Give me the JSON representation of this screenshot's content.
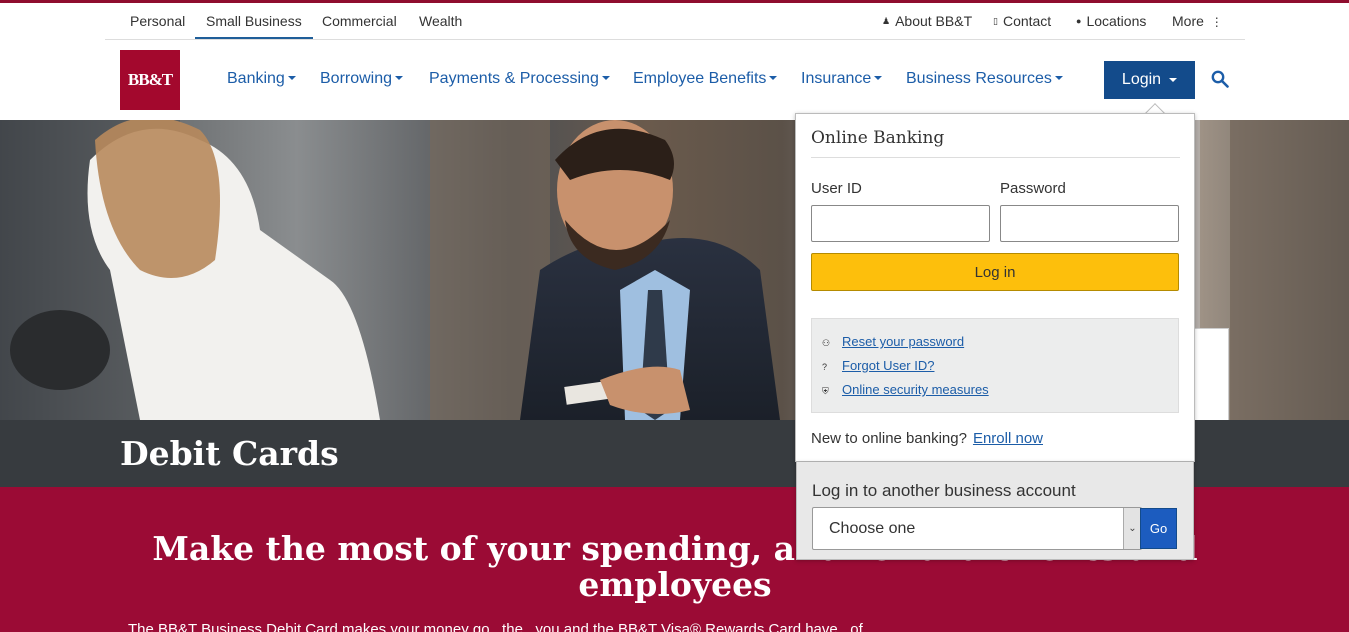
{
  "brand": {
    "logo_text": "BB&T",
    "accent": "#a3082d",
    "nav_blue": "#1c5da8",
    "login_blue": "#134b8b",
    "cta_yellow": "#fdbf0c",
    "promo_red": "#9b0b35"
  },
  "segments": [
    {
      "label": "Personal",
      "active": false
    },
    {
      "label": "Small Business",
      "active": true
    },
    {
      "label": "Commercial",
      "active": false
    },
    {
      "label": "Wealth",
      "active": false
    }
  ],
  "utility": {
    "about": {
      "label": "About BB&T",
      "icon": "person-icon"
    },
    "contact": {
      "label": "Contact",
      "icon": "phone-icon"
    },
    "locations": {
      "label": "Locations",
      "icon": "location-pin-icon"
    },
    "more": {
      "label": "More",
      "icon": "kebab-icon"
    }
  },
  "nav": [
    "Banking",
    "Borrowing",
    "Payments & Processing",
    "Employee Benefits",
    "Insurance",
    "Business Resources"
  ],
  "login_button": "Login",
  "login_panel": {
    "title": "Online Banking",
    "user_id_label": "User ID",
    "password_label": "Password",
    "user_id_value": "",
    "password_value": "",
    "submit": "Log in",
    "help_links": [
      {
        "label": "Reset your password",
        "icon": "key-icon"
      },
      {
        "label": "Forgot User ID?",
        "icon": "question-icon"
      },
      {
        "label": "Online security measures",
        "icon": "shield-icon"
      }
    ],
    "enroll_prompt": "New to online banking?",
    "enroll_link": "Enroll now"
  },
  "other_account": {
    "label": "Log in to another business account",
    "select_value": "Choose one",
    "go": "Go"
  },
  "page_title": "Debit Cards",
  "promo": {
    "headline": "Make the most of your spending, and reward clients and employees",
    "text": "The BB&T Business Debit Card makes your money go...the...you and the BB&T Visa® Rewards Card have...of..."
  }
}
